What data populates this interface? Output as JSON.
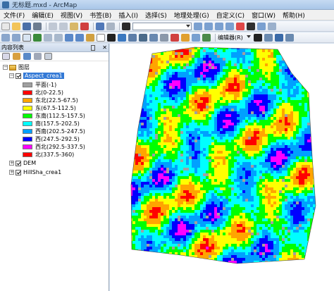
{
  "window": {
    "title": "无标题.mxd - ArcMap"
  },
  "menu": [
    "文件(F)",
    "编辑(E)",
    "视图(V)",
    "书签(B)",
    "插入(I)",
    "选择(S)",
    "地理处理(G)",
    "自定义(C)",
    "窗口(W)",
    "帮助(H)"
  ],
  "toolbar": {
    "editor_label": "编辑器(R)"
  },
  "toc": {
    "title": "内容列表",
    "close_glyph": "✕",
    "root_label": "图层",
    "layers": [
      {
        "name": "Aspect_crea1",
        "checked": true,
        "expanded": true,
        "selected": true,
        "classes": [
          {
            "label": "平面(-1)",
            "color": "#a0a0a0"
          },
          {
            "label": "北(0-22.5)",
            "color": "#ff0000"
          },
          {
            "label": "东北(22.5-67.5)",
            "color": "#ffa500"
          },
          {
            "label": "东(67.5-112.5)",
            "color": "#ffff00"
          },
          {
            "label": "东南(112.5-157.5)",
            "color": "#00ff00"
          },
          {
            "label": "南(157.5-202.5)",
            "color": "#00ffff"
          },
          {
            "label": "西南(202.5-247.5)",
            "color": "#00a0ff"
          },
          {
            "label": "西(247.5-292.5)",
            "color": "#0000ff"
          },
          {
            "label": "西北(292.5-337.5)",
            "color": "#ff00ff"
          },
          {
            "label": "北(337.5-360)",
            "color": "#ff0000"
          }
        ]
      },
      {
        "name": "DEM",
        "checked": true,
        "expanded": false,
        "selected": false
      },
      {
        "name": "HillSha_crea1",
        "checked": true,
        "expanded": false,
        "selected": false
      }
    ]
  },
  "map": {
    "palette": [
      "#ff0000",
      "#ffa500",
      "#ffff00",
      "#00ff00",
      "#00ffff",
      "#00a0ff",
      "#0000ff",
      "#ff00ff",
      "#a0a0a0"
    ]
  }
}
